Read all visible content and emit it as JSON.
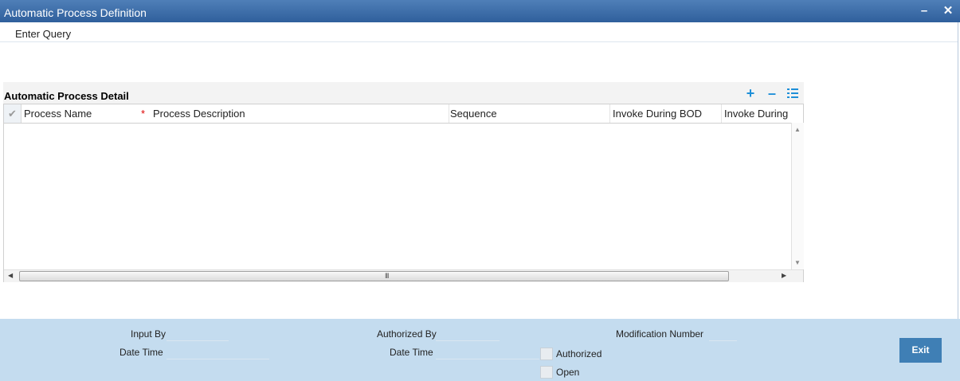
{
  "window": {
    "title": "Automatic Process Definition",
    "minimize_icon": "minimize-icon",
    "close_icon": "close-icon"
  },
  "toolbar": {
    "enter_query_label": "Enter Query"
  },
  "detail": {
    "title": "Automatic Process Detail",
    "add_icon": "plus-icon",
    "delete_icon": "minus-icon",
    "view_icon": "list-icon",
    "columns": [
      "Process Name",
      "Process Description",
      "Sequence",
      "Invoke During BOD",
      "Invoke During I"
    ],
    "required_marker": "*",
    "select_all_icon": "checkmark-icon",
    "hscroll_grip": "III"
  },
  "footer": {
    "input_by_label": "Input By",
    "input_by_value": "",
    "date_time_label": "Date Time",
    "date_time_value": "",
    "authorized_by_label": "Authorized By",
    "authorized_by_value": "",
    "auth_date_time_label": "Date Time",
    "auth_date_time_value": "",
    "modification_number_label": "Modification Number",
    "modification_number_value": "",
    "authorized_label": "Authorized",
    "authorized_checked": false,
    "open_label": "Open",
    "open_checked": false,
    "exit_label": "Exit"
  },
  "colors": {
    "titlebar": "#3d6eab",
    "footer": "#c4dcef",
    "accent_icon": "#1e8fd8",
    "exit_button": "#3f7fb5",
    "required": "#dd0000"
  }
}
